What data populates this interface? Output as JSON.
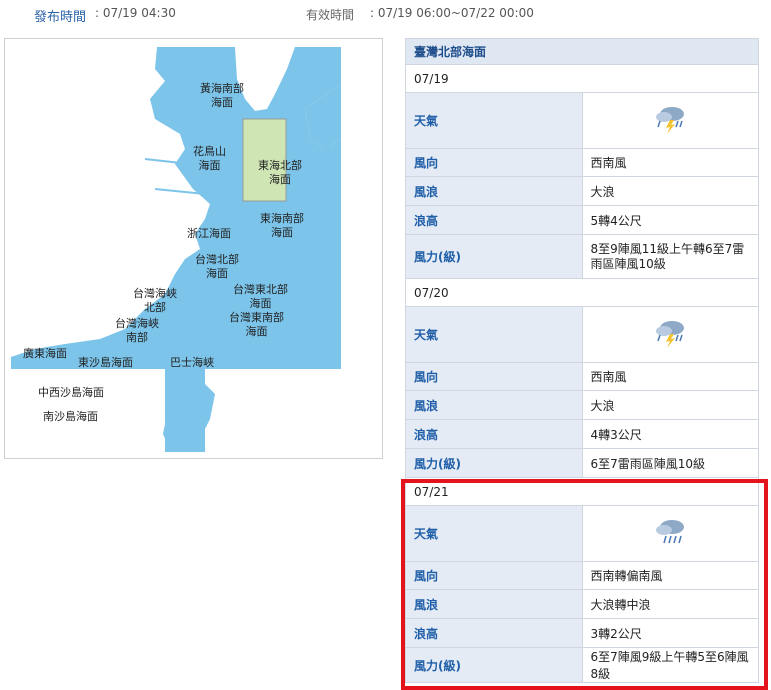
{
  "header": {
    "issue_label": "發布時間",
    "issue_value": ": 07/19 04:30",
    "valid_label": "有效時間",
    "valid_value": ": 07/19 06:00~07/22 00:00"
  },
  "map": {
    "labels": {
      "yellow_sea_south": "黃海南部\n海面",
      "huaniaoshan": "花鳥山\n海面",
      "east_china_sea_north": "東海北部\n海面",
      "east_china_sea_south": "東海南部\n海面",
      "zhejiang": "浙江海面",
      "taiwan_north": "台灣北部\n海面",
      "taiwan_strait_north": "台灣海峽\n北部",
      "taiwan_strait_south": "台灣海峽\n南部",
      "taiwan_northeast": "台灣東北部\n海面",
      "taiwan_southeast": "台灣東南部\n海面",
      "guangdong": "廣東海面",
      "dongsha": "東沙島海面",
      "bashi": "巴士海峽",
      "central_west_sha": "中西沙島海面",
      "nansha": "南沙島海面"
    },
    "colors": {
      "sea": "#7cc4ea",
      "land": "#ffffff",
      "highlight_zone": "#cfe5b4"
    }
  },
  "forecast": {
    "region": "臺灣北部海面",
    "row_labels": {
      "weather": "天氣",
      "wind_dir": "風向",
      "wave": "風浪",
      "wave_height": "浪高",
      "wind_force": "風力(級)"
    },
    "days": [
      {
        "date": "07/19",
        "weather_icon": "thunderstorm-icon",
        "wind_dir": "西南風",
        "wave": "大浪",
        "wave_height": "5轉4公尺",
        "wind_force": "8至9陣風11級上午轉6至7雷雨區陣風10級"
      },
      {
        "date": "07/20",
        "weather_icon": "thunderstorm-icon",
        "wind_dir": "西南風",
        "wave": "大浪",
        "wave_height": "4轉3公尺",
        "wind_force": "6至7雷雨區陣風10級"
      },
      {
        "date": "07/21",
        "weather_icon": "rain-cloud-icon",
        "wind_dir": "西南轉偏南風",
        "wave": "大浪轉中浪",
        "wave_height": "3轉2公尺",
        "wind_force": "6至7陣風9級上午轉5至6陣風8級"
      }
    ]
  },
  "annotation": {
    "highlight_color": "#e3141b"
  }
}
